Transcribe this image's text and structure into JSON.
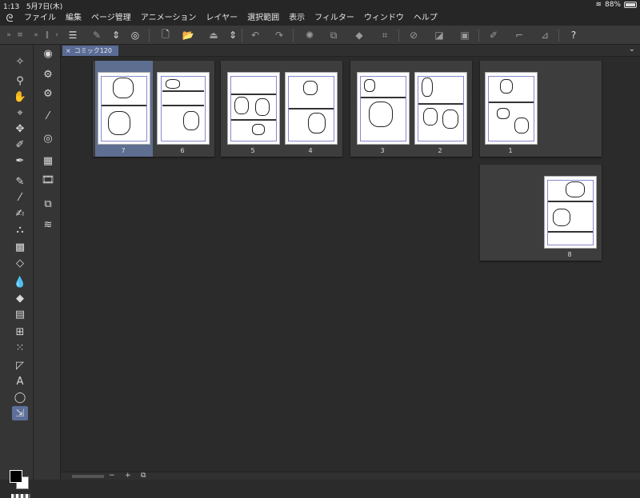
{
  "status": {
    "time": "1:13",
    "date": "5月7日(木)",
    "battery": "88%",
    "battery_level": 0.88
  },
  "menubar": {
    "items": [
      "ファイル",
      "編集",
      "ページ管理",
      "アニメーション",
      "レイヤー",
      "選択範囲",
      "表示",
      "フィルター",
      "ウィンドウ",
      "ヘルプ"
    ]
  },
  "tab": {
    "label": "コミック120",
    "close": "×"
  },
  "pages": [
    {
      "num": "7"
    },
    {
      "num": "6"
    },
    {
      "num": "5"
    },
    {
      "num": "4"
    },
    {
      "num": "3"
    },
    {
      "num": "2"
    },
    {
      "num": "1"
    },
    {
      "num": "8"
    }
  ],
  "bottom": {
    "minus": "−",
    "plus": "+"
  }
}
